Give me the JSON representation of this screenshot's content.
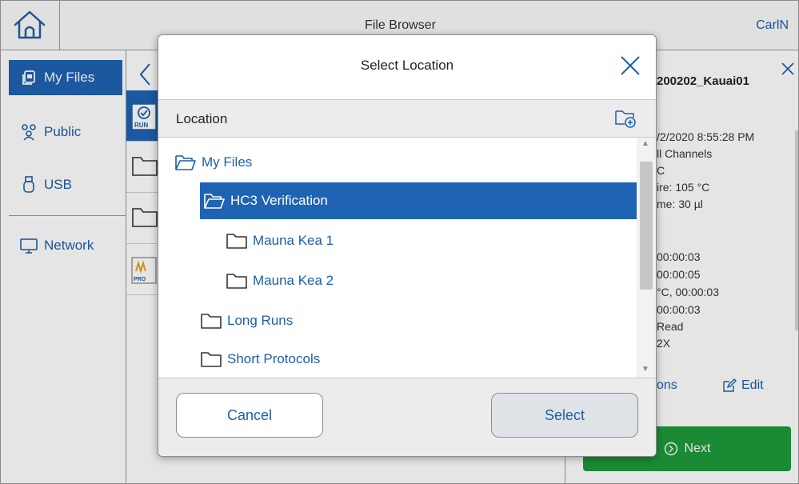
{
  "header": {
    "title": "File Browser",
    "user": "CarlN"
  },
  "sidebar": {
    "items": [
      {
        "label": "My Files",
        "icon": "my-files-icon",
        "active": true
      },
      {
        "label": "Public",
        "icon": "people-icon",
        "active": false
      },
      {
        "label": "USB",
        "icon": "usb-icon",
        "active": false
      },
      {
        "label": "Network",
        "icon": "monitor-icon",
        "active": false
      }
    ]
  },
  "detail": {
    "title": "200202_Kauai01",
    "lines": [
      "/2/2020 8:55:28 PM",
      "ll Channels",
      "C",
      "ire: 105 °C",
      "me: 30 µl",
      "00:00:03",
      "00:00:05",
      "°C, 00:00:03",
      "00:00:03",
      "Read",
      "2X"
    ],
    "options_label": "ons",
    "edit_label": "Edit",
    "next_label": "Next"
  },
  "modal": {
    "title": "Select Location",
    "location_label": "Location",
    "tree": [
      {
        "label": "My Files",
        "level": 0,
        "open": true,
        "selected": false
      },
      {
        "label": "HC3 Verification",
        "level": 1,
        "open": true,
        "selected": true
      },
      {
        "label": "Mauna Kea 1",
        "level": 2,
        "open": false,
        "selected": false
      },
      {
        "label": "Mauna Kea 2",
        "level": 2,
        "open": false,
        "selected": false
      },
      {
        "label": "Long Runs",
        "level": 1,
        "open": false,
        "selected": false
      },
      {
        "label": "Short Protocols",
        "level": 1,
        "open": false,
        "selected": false
      }
    ],
    "cancel_label": "Cancel",
    "select_label": "Select"
  },
  "colors": {
    "accent": "#1f63b3",
    "link": "#1e5fa8",
    "next_green": "#1f9a3c"
  }
}
